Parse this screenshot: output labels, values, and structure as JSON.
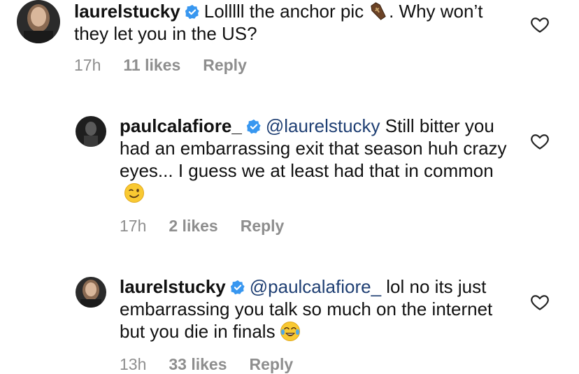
{
  "comments": [
    {
      "username": "laurelstucky",
      "mention": "",
      "body": "Lolllll the anchor pic",
      "body_after_emoji": ". Why won’t they let you in the US?",
      "emoji": "coffin",
      "time": "17h",
      "likes": "11 likes",
      "reply": "Reply"
    },
    {
      "username": "paulcalafiore_",
      "mention": "@laurelstucky",
      "body": "Still bitter you had an embarrassing exit that season huh crazy eyes... I guess we at least had that in common",
      "emoji": "winking-face",
      "time": "17h",
      "likes": "2 likes",
      "reply": "Reply"
    },
    {
      "username": "laurelstucky",
      "mention": "@paulcalafiore_",
      "body": "lol no its just embarrassing you talk so much on the internet but you die in finals",
      "emoji": "tears-of-joy",
      "time": "13h",
      "likes": "33 likes",
      "reply": "Reply"
    }
  ],
  "colors": {
    "meta": "#8e8e8e",
    "mention": "#1f3f73",
    "verified": "#3897f0"
  },
  "icons": {
    "like": "heart-outline-icon",
    "verified": "verified-badge-icon"
  }
}
